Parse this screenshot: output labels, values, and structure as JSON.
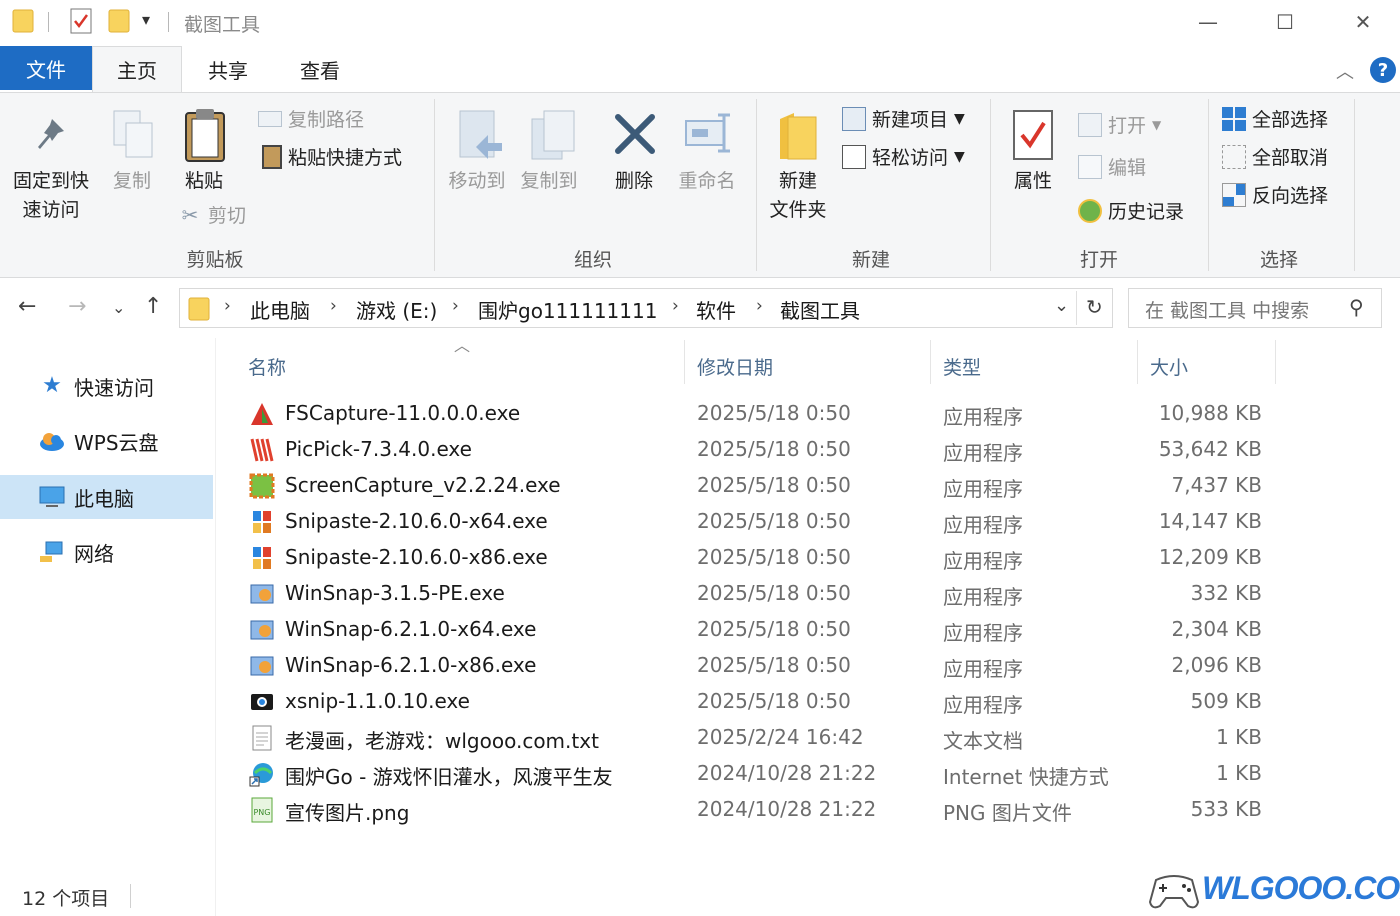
{
  "window": {
    "title": "截图工具",
    "controls": {
      "minimize": "—",
      "maximize": "☐",
      "close": "✕"
    }
  },
  "tabs": {
    "file": "文件",
    "items": [
      "主页",
      "共享",
      "查看"
    ],
    "active": "主页"
  },
  "ribbon": {
    "clipboard": {
      "group_label": "剪贴板",
      "pin_label_1": "固定到快",
      "pin_label_2": "速访问",
      "copy": "复制",
      "paste": "粘贴",
      "copy_path": "复制路径",
      "paste_shortcut": "粘贴快捷方式",
      "cut": "剪切"
    },
    "organize": {
      "group_label": "组织",
      "move_to": "移动到",
      "copy_to": "复制到",
      "delete": "删除",
      "rename": "重命名"
    },
    "new": {
      "group_label": "新建",
      "new_folder_1": "新建",
      "new_folder_2": "文件夹",
      "new_item": "新建项目",
      "easy_access": "轻松访问"
    },
    "open": {
      "group_label": "打开",
      "properties": "属性",
      "open": "打开",
      "edit": "编辑",
      "history": "历史记录"
    },
    "select": {
      "group_label": "选择",
      "select_all": "全部选择",
      "select_none": "全部取消",
      "invert": "反向选择"
    }
  },
  "address": {
    "crumbs": [
      "此电脑",
      "游戏 (E:)",
      "围炉go111111111",
      "软件",
      "截图工具"
    ],
    "search_placeholder": "在 截图工具 中搜索"
  },
  "navpane": {
    "items": [
      {
        "label": "快速访问",
        "icon": "star-icon"
      },
      {
        "label": "WPS云盘",
        "icon": "cloud-icon"
      },
      {
        "label": "此电脑",
        "icon": "computer-icon",
        "selected": true
      },
      {
        "label": "网络",
        "icon": "network-icon"
      }
    ]
  },
  "columns": {
    "name": "名称",
    "date": "修改日期",
    "type": "类型",
    "size": "大小"
  },
  "files": [
    {
      "name": "FSCapture-11.0.0.0.exe",
      "date": "2025/5/18 0:50",
      "type": "应用程序",
      "size": "10,988 KB",
      "icon": "fscapture-icon"
    },
    {
      "name": "PicPick-7.3.4.0.exe",
      "date": "2025/5/18 0:50",
      "type": "应用程序",
      "size": "53,642 KB",
      "icon": "picpick-icon"
    },
    {
      "name": "ScreenCapture_v2.2.24.exe",
      "date": "2025/5/18 0:50",
      "type": "应用程序",
      "size": "7,437 KB",
      "icon": "screencapture-icon"
    },
    {
      "name": "Snipaste-2.10.6.0-x64.exe",
      "date": "2025/5/18 0:50",
      "type": "应用程序",
      "size": "14,147 KB",
      "icon": "snipaste-icon"
    },
    {
      "name": "Snipaste-2.10.6.0-x86.exe",
      "date": "2025/5/18 0:50",
      "type": "应用程序",
      "size": "12,209 KB",
      "icon": "snipaste-icon"
    },
    {
      "name": "WinSnap-3.1.5-PE.exe",
      "date": "2025/5/18 0:50",
      "type": "应用程序",
      "size": "332 KB",
      "icon": "winsnap-icon"
    },
    {
      "name": "WinSnap-6.2.1.0-x64.exe",
      "date": "2025/5/18 0:50",
      "type": "应用程序",
      "size": "2,304 KB",
      "icon": "winsnap-icon"
    },
    {
      "name": "WinSnap-6.2.1.0-x86.exe",
      "date": "2025/5/18 0:50",
      "type": "应用程序",
      "size": "2,096 KB",
      "icon": "winsnap-icon"
    },
    {
      "name": "xsnip-1.1.0.10.exe",
      "date": "2025/5/18 0:50",
      "type": "应用程序",
      "size": "509 KB",
      "icon": "xsnip-icon"
    },
    {
      "name": "老漫画，老游戏：wlgooo.com.txt",
      "date": "2025/2/24 16:42",
      "type": "文本文档",
      "size": "1 KB",
      "icon": "text-file-icon"
    },
    {
      "name": "围炉Go - 游戏怀旧灌水，风渡平生友",
      "date": "2024/10/28 21:22",
      "type": "Internet 快捷方式",
      "size": "1 KB",
      "icon": "internet-shortcut-icon"
    },
    {
      "name": "宣传图片.png",
      "date": "2024/10/28 21:22",
      "type": "PNG 图片文件",
      "size": "533 KB",
      "icon": "png-file-icon"
    }
  ],
  "status": {
    "item_count": "12 个项目"
  },
  "watermark": {
    "text": "WLGOOO.COM"
  }
}
